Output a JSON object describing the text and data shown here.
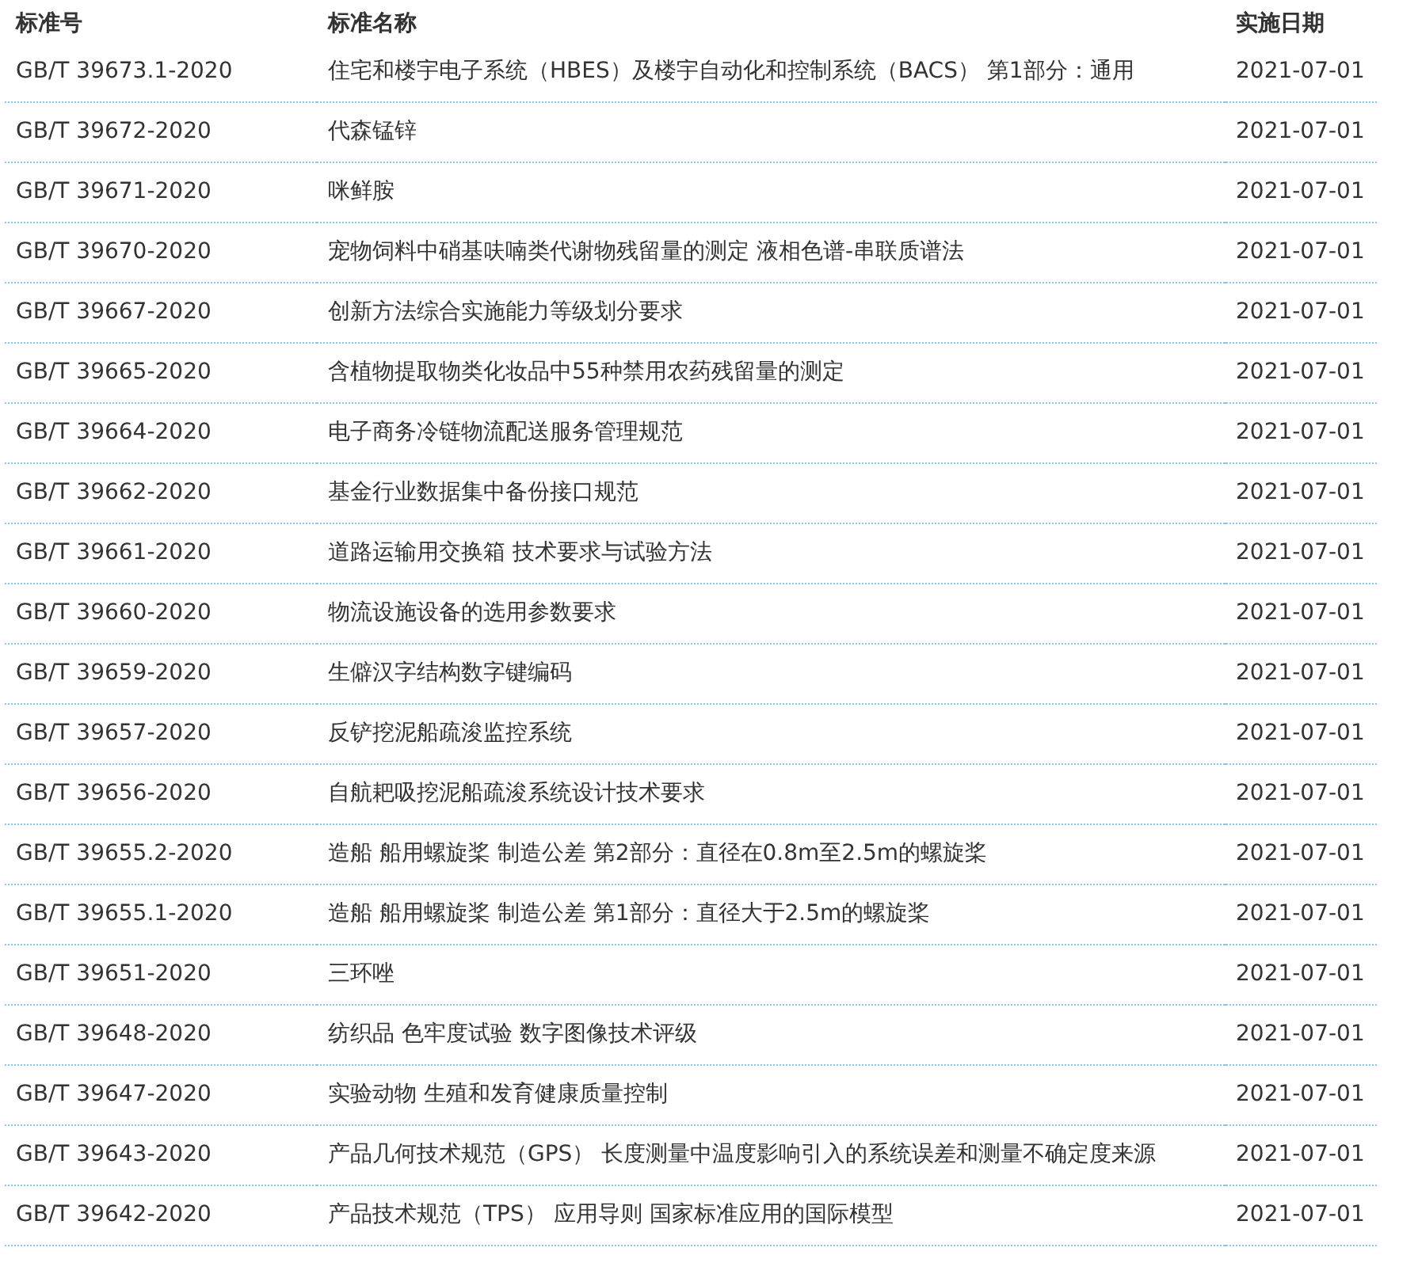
{
  "table": {
    "columns": [
      "标准号",
      "标准名称",
      "实施日期"
    ],
    "rows": [
      [
        "GB/T 39673.1-2020",
        "住宅和楼宇电子系统（HBES）及楼宇自动化和控制系统（BACS） 第1部分：通用",
        "2021-07-01"
      ],
      [
        "GB/T 39672-2020",
        "代森锰锌",
        "2021-07-01"
      ],
      [
        "GB/T 39671-2020",
        "咪鲜胺",
        "2021-07-01"
      ],
      [
        "GB/T 39670-2020",
        "宠物饲料中硝基呋喃类代谢物残留量的测定 液相色谱-串联质谱法",
        "2021-07-01"
      ],
      [
        "GB/T 39667-2020",
        "创新方法综合实施能力等级划分要求",
        "2021-07-01"
      ],
      [
        "GB/T 39665-2020",
        "含植物提取物类化妆品中55种禁用农药残留量的测定",
        "2021-07-01"
      ],
      [
        "GB/T 39664-2020",
        "电子商务冷链物流配送服务管理规范",
        "2021-07-01"
      ],
      [
        "GB/T 39662-2020",
        "基金行业数据集中备份接口规范",
        "2021-07-01"
      ],
      [
        "GB/T 39661-2020",
        "道路运输用交换箱 技术要求与试验方法",
        "2021-07-01"
      ],
      [
        "GB/T 39660-2020",
        "物流设施设备的选用参数要求",
        "2021-07-01"
      ],
      [
        "GB/T 39659-2020",
        "生僻汉字结构数字键编码",
        "2021-07-01"
      ],
      [
        "GB/T 39657-2020",
        "反铲挖泥船疏浚监控系统",
        "2021-07-01"
      ],
      [
        "GB/T 39656-2020",
        "自航耙吸挖泥船疏浚系统设计技术要求",
        "2021-07-01"
      ],
      [
        "GB/T 39655.2-2020",
        "造船 船用螺旋桨 制造公差 第2部分：直径在0.8m至2.5m的螺旋桨",
        "2021-07-01"
      ],
      [
        "GB/T 39655.1-2020",
        "造船 船用螺旋桨 制造公差 第1部分：直径大于2.5m的螺旋桨",
        "2021-07-01"
      ],
      [
        "GB/T 39651-2020",
        "三环唑",
        "2021-07-01"
      ],
      [
        "GB/T 39648-2020",
        "纺织品 色牢度试验 数字图像技术评级",
        "2021-07-01"
      ],
      [
        "GB/T 39647-2020",
        "实验动物 生殖和发育健康质量控制",
        "2021-07-01"
      ],
      [
        "GB/T 39643-2020",
        "产品几何技术规范（GPS） 长度测量中温度影响引入的系统误差和测量不确定度来源",
        "2021-07-01"
      ],
      [
        "GB/T 39642-2020",
        "产品技术规范（TPS） 应用导则 国家标准应用的国际模型",
        "2021-07-01"
      ]
    ]
  }
}
